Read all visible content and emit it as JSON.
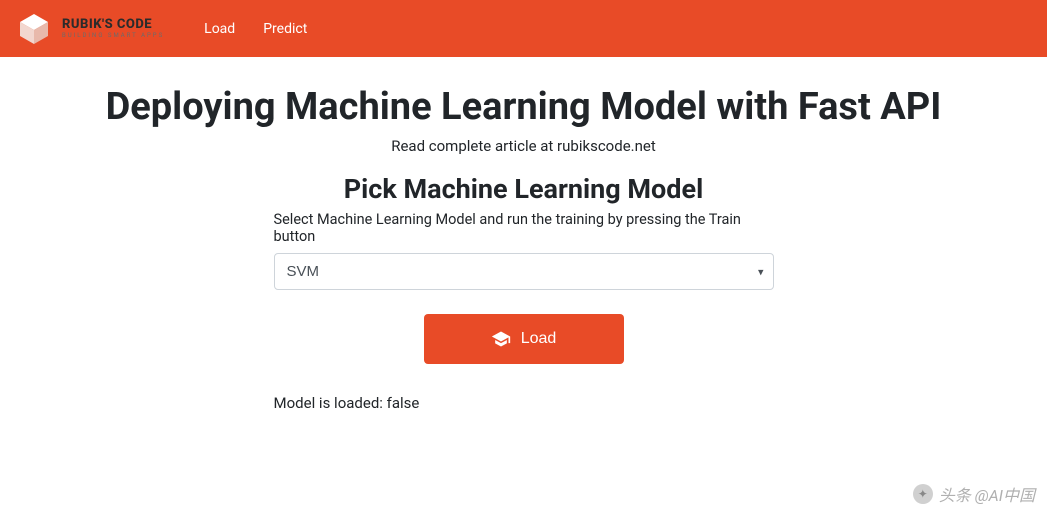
{
  "brand": {
    "title": "RUBIK'S CODE",
    "subtitle": "BUILDING SMART APPS"
  },
  "nav": {
    "items": [
      {
        "label": "Load"
      },
      {
        "label": "Predict"
      }
    ]
  },
  "main": {
    "title": "Deploying Machine Learning Model with Fast API",
    "subtitle": "Read complete article at rubikscode.net"
  },
  "section": {
    "title": "Pick Machine Learning Model",
    "description": "Select Machine Learning Model and run the training by pressing the Train button",
    "select_value": "SVM",
    "load_button": "Load",
    "status": "Model is loaded: false"
  },
  "watermark": {
    "text": "头条 @AI中国"
  },
  "colors": {
    "accent": "#e84b27"
  }
}
